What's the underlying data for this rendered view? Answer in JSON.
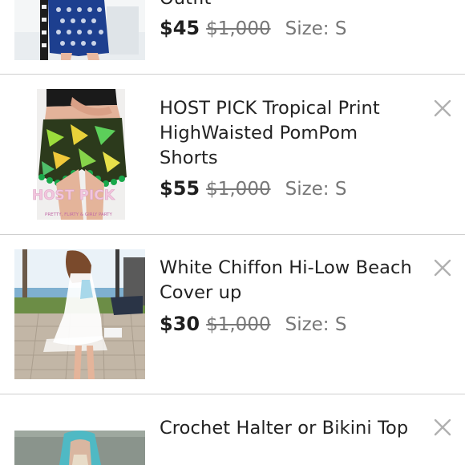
{
  "items": [
    {
      "title": "Outfit",
      "price": "$45",
      "original_price": "$1,000",
      "size": "Size: S",
      "close_icon": "close-icon"
    },
    {
      "title": "HOST PICK Tropical Print HighWaisted PomPom Shorts",
      "price": "$55",
      "original_price": "$1,000",
      "size": "Size: S",
      "thumb_overlay": "HOST PICK",
      "thumb_footer": "PRETTY, FLIRTY & GIRLY PARTY",
      "close_icon": "close-icon"
    },
    {
      "title": "White Chiffon Hi-Low Beach Cover up",
      "price": "$30",
      "original_price": "$1,000",
      "size": "Size: S",
      "close_icon": "close-icon"
    },
    {
      "title": "Crochet Halter or Bikini Top",
      "close_icon": "close-icon"
    }
  ],
  "colors": {
    "divider": "#cfcfcf",
    "price": "#1f1f1f",
    "muted": "#777777",
    "close_icon": "#b0b0b0"
  }
}
